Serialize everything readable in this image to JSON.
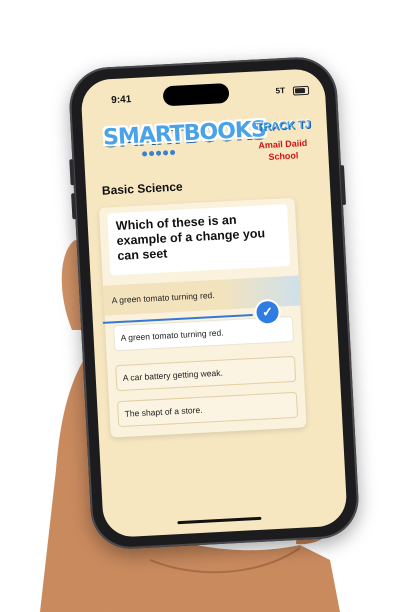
{
  "status_bar": {
    "time": "9:41",
    "signal": "5T"
  },
  "header": {
    "logo": "SMARTBOOKS",
    "track": "TRACK TJ",
    "school_line1": "Amail Daiid",
    "school_line2": "School"
  },
  "subject": "Basic Science",
  "question": "Which of these is an example of a change you can seet",
  "selected_answer_banner": "A green tomato turning red.",
  "options": [
    {
      "label": "A green tomato turning red.",
      "selected": true
    },
    {
      "label": "A car battery getting weak.",
      "selected": false
    },
    {
      "label": "The shapt of a store.",
      "selected": false
    }
  ],
  "colors": {
    "screen_bg": "#f6e7c1",
    "logo_blue": "#4aa3e8",
    "school_red": "#d11414",
    "accent_blue": "#2f7de3"
  },
  "icons": {
    "check": "check-icon"
  }
}
